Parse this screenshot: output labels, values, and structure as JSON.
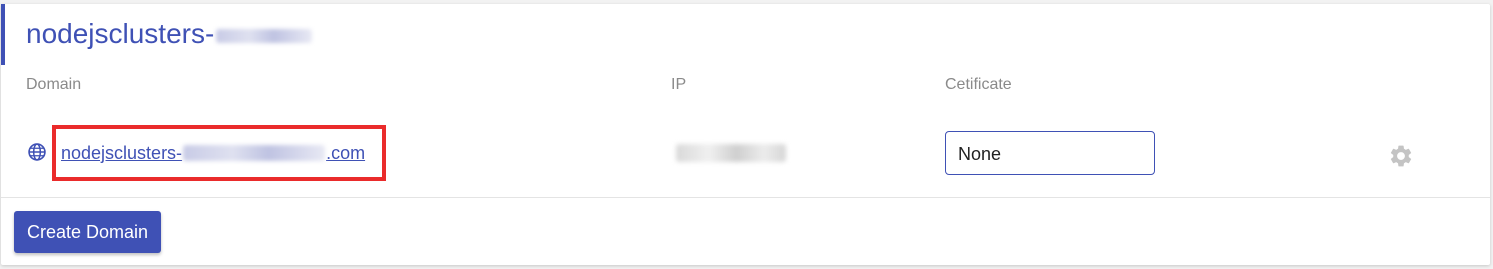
{
  "cluster": {
    "title": "nodejsclusters-"
  },
  "table": {
    "headers": {
      "domain": "Domain",
      "ip": "IP",
      "certificate": "Cetificate"
    },
    "rows": [
      {
        "domain_prefix": "nodejsclusters-",
        "domain_suffix": ".com",
        "certificate": "None"
      }
    ]
  },
  "actions": {
    "create_domain": "Create Domain"
  },
  "colors": {
    "accent": "#3f51b5",
    "highlight": "#ea2b2b",
    "gear": "#c4c4c4"
  },
  "icons": {
    "domain_row": "globe-icon",
    "row_settings": "gear-icon"
  }
}
